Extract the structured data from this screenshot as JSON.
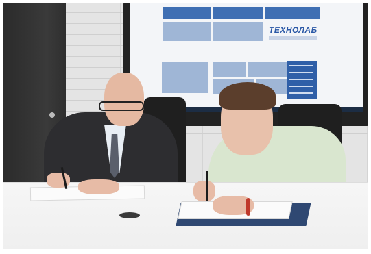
{
  "photo": {
    "description_label": "",
    "screen": {
      "logo_text": "ТЕХНОЛАБ"
    }
  }
}
